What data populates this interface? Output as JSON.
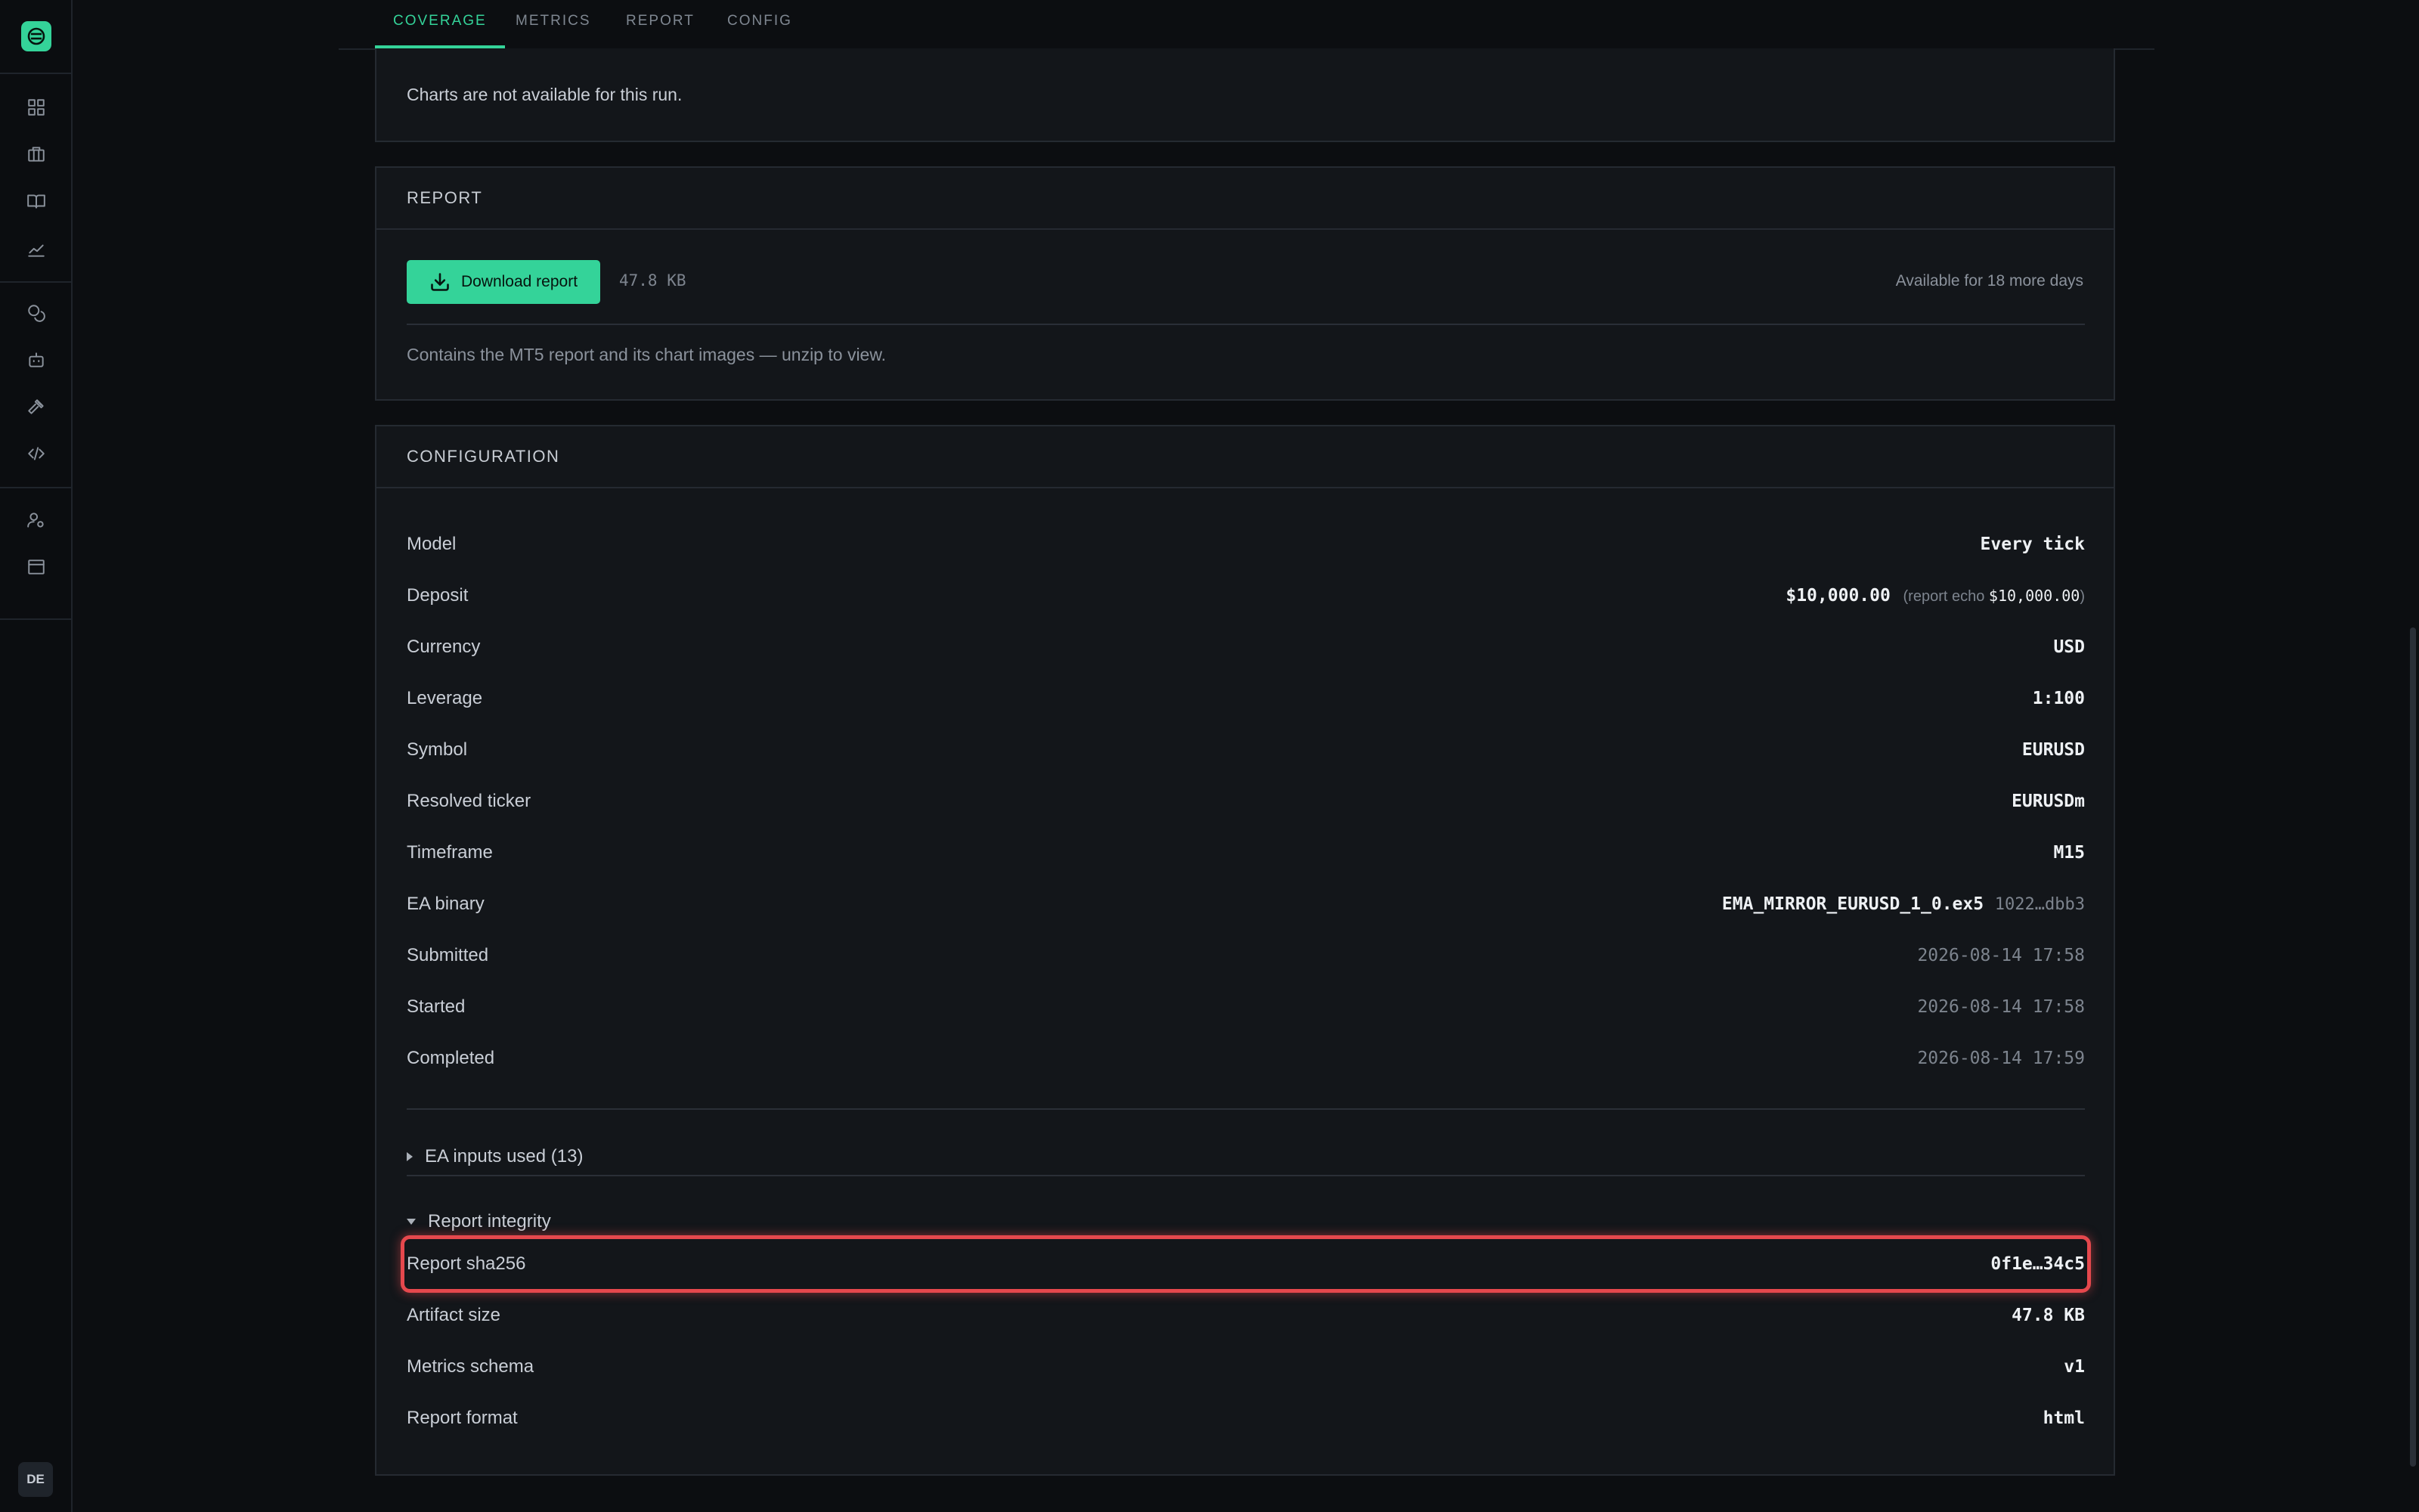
{
  "sidebar": {
    "avatar_initials": "DE",
    "icons": [
      "dashboard-icon",
      "briefcase-icon",
      "book-icon",
      "chart-line-icon",
      "coins-icon",
      "robot-icon",
      "hammer-icon",
      "code-icon",
      "user-settings-icon",
      "archive-icon"
    ]
  },
  "tabs": [
    {
      "label": "COVERAGE",
      "active": true
    },
    {
      "label": "METRICS",
      "active": false
    },
    {
      "label": "REPORT",
      "active": false
    },
    {
      "label": "CONFIG",
      "active": false
    }
  ],
  "coverage": {
    "message": "Charts are not available for this run."
  },
  "report": {
    "title": "REPORT",
    "download_label": "Download report",
    "size": "47.8 KB",
    "availability": "Available for 18 more days",
    "description": "Contains the MT5 report and its chart images — unzip to view."
  },
  "configuration": {
    "title": "CONFIGURATION",
    "rows": [
      {
        "label": "Model",
        "value": "Every tick"
      },
      {
        "label": "Deposit",
        "value": "$10,000.00",
        "echo_prefix": "(report echo ",
        "echo_value": "$10,000.00",
        "echo_suffix": ")"
      },
      {
        "label": "Currency",
        "value": "USD"
      },
      {
        "label": "Leverage",
        "value": "1:100"
      },
      {
        "label": "Symbol",
        "value": "EURUSD"
      },
      {
        "label": "Resolved ticker",
        "value": "EURUSDm"
      },
      {
        "label": "Timeframe",
        "value": "M15"
      },
      {
        "label": "EA binary",
        "value": "EMA_MIRROR_EURUSD_1_0.ex5",
        "hash": "1022…dbb3"
      },
      {
        "label": "Submitted",
        "value": "2026-08-14 17:58"
      },
      {
        "label": "Started",
        "value": "2026-08-14 17:58"
      },
      {
        "label": "Completed",
        "value": "2026-08-14 17:59"
      }
    ],
    "ea_inputs_label": "EA inputs used (13)",
    "integrity_label": "Report integrity",
    "integrity_rows": [
      {
        "label": "Report sha256",
        "value": "0f1e…34c5"
      },
      {
        "label": "Artifact size",
        "value": "47.8 KB"
      },
      {
        "label": "Metrics schema",
        "value": "v1"
      },
      {
        "label": "Report format",
        "value": "html"
      }
    ]
  },
  "colors": {
    "accent": "#34d399",
    "highlight": "#e5484d",
    "background": "#0c0e11",
    "panel": "#13161a"
  }
}
